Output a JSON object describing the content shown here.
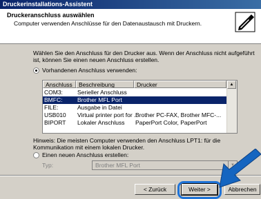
{
  "window": {
    "title": "Druckerinstallations-Assistent"
  },
  "header": {
    "title": "Druckeranschluss auswählen",
    "subtitle": "Computer verwenden Anschlüsse für den Datenaustausch mit Druckern."
  },
  "body": {
    "intro_line1": "Wählen Sie den Anschluss für den Drucker aus. Wenn der Anschluss nicht aufgeführt",
    "intro_line2": "ist, können Sie einen neuen Anschluss erstellen.",
    "radio_existing": {
      "label": "Vorhandenen Anschluss verwenden:",
      "checked": true
    },
    "radio_new": {
      "label": "Einen neuen Anschluss erstellen:",
      "checked": false
    },
    "hint_line1": "Hinweis: Die meisten Computer verwenden den Anschluss LPT1: für die",
    "hint_line2": "Kommunikation mit einem lokalen Drucker.",
    "type_label": "Typ:",
    "type_value": "Brother MFL Port"
  },
  "port_list": {
    "columns": [
      "Anschluss",
      "Beschreibung",
      "Drucker"
    ],
    "rows": [
      {
        "port": "COM3:",
        "desc": "Serieller Anschluss",
        "printer": ""
      },
      {
        "port": "BMFC:",
        "desc": "Brother MFL Port",
        "printer": "",
        "selected": true
      },
      {
        "port": "FILE:",
        "desc": "Ausgabe in Datei",
        "printer": ""
      },
      {
        "port": "USB010",
        "desc": "Virtual printer port for ...",
        "printer": "Brother PC-FAX, Brother MFC-..."
      },
      {
        "port": "BIPORT",
        "desc": "Lokaler Anschluss",
        "printer": "PaperPort Color, PaperPort"
      }
    ]
  },
  "buttons": {
    "back": "< Zurück",
    "next": "Weiter >",
    "cancel": "Abbrechen"
  },
  "colors": {
    "selection": "#0a246a",
    "highlight_ring": "#1e73d8",
    "arrow": "#1565c0"
  }
}
